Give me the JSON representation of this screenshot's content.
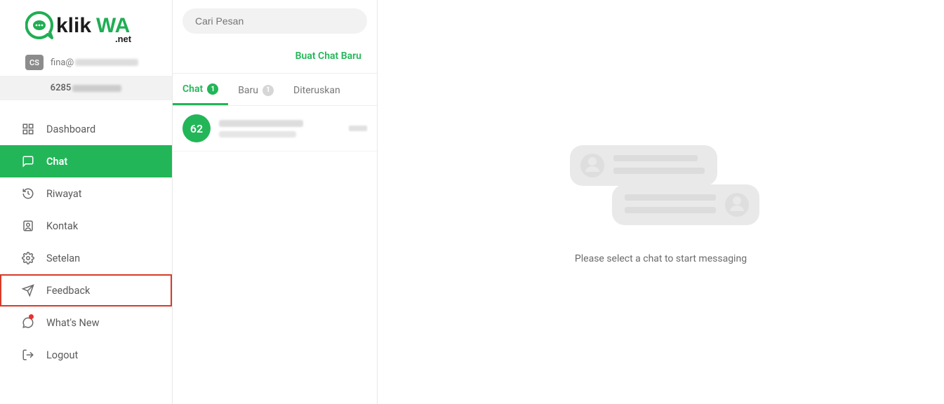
{
  "brand": {
    "name": "klikWA",
    "suffix": ".net"
  },
  "user": {
    "badge": "CS",
    "email_prefix": "fina@"
  },
  "phone": {
    "prefix": "6285"
  },
  "nav": {
    "dashboard": "Dashboard",
    "chat": "Chat",
    "riwayat": "Riwayat",
    "kontak": "Kontak",
    "setelan": "Setelan",
    "feedback": "Feedback",
    "whatsnew": "What's New",
    "logout": "Logout"
  },
  "chatlist": {
    "search_placeholder": "Cari Pesan",
    "new_chat": "Buat Chat Baru",
    "tabs": {
      "chat": {
        "label": "Chat",
        "count": "1"
      },
      "baru": {
        "label": "Baru",
        "count": "1"
      },
      "diteruskan": {
        "label": "Diteruskan"
      }
    },
    "conversations": [
      {
        "avatar_text": "62"
      }
    ]
  },
  "main": {
    "empty_text": "Please select a chat to start messaging"
  }
}
